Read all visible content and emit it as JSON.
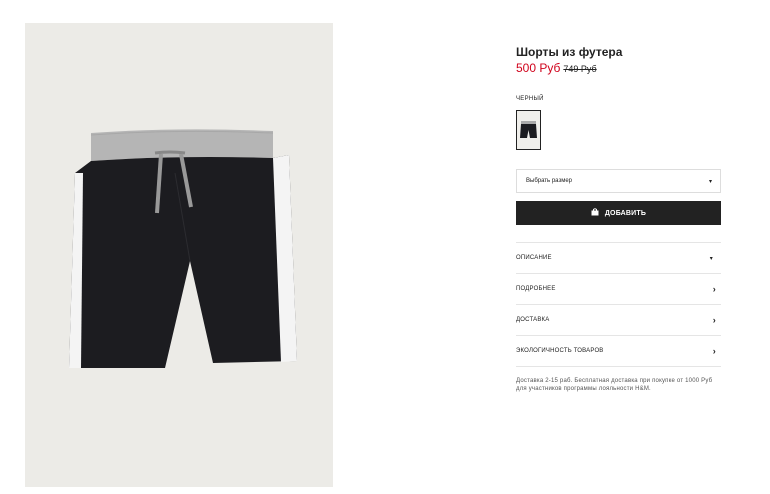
{
  "product": {
    "title": "Шорты из футера",
    "price_sale": "500 Руб",
    "price_old": "749 Руб",
    "image_icon": "shorts-image"
  },
  "color": {
    "label": "ЧЕРНЫЙ"
  },
  "size": {
    "placeholder": "Выбрать размер",
    "caret": "▾"
  },
  "add_button": {
    "label": "ДОБАВИТЬ"
  },
  "accordion": [
    {
      "label": "ОПИСАНИЕ",
      "icon": "▾"
    },
    {
      "label": "ПОДРОБНЕЕ",
      "icon": "›"
    },
    {
      "label": "ДОСТАВКА",
      "icon": "›"
    },
    {
      "label": "ЭКОЛОГИЧНОСТЬ ТОВАРОВ",
      "icon": "›"
    }
  ],
  "delivery_note": "Доставка 2-15 раб. Бесплатная доставка при покупке от 1000 Руб для участников программы лояльности H&M.",
  "colors": {
    "sale": "#d0021b",
    "button_bg": "#222222",
    "image_bg": "#ecebe7"
  }
}
